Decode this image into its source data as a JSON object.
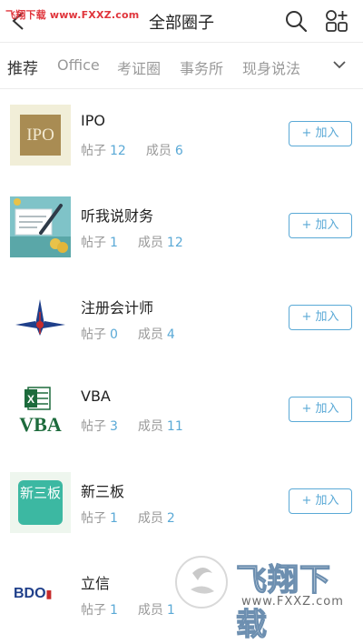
{
  "watermark_top": "飞翔下载 www.FXXZ.com",
  "header": {
    "title": "全部圈子",
    "icons": [
      "back-icon",
      "search-icon",
      "add-group-icon"
    ]
  },
  "tabs": [
    {
      "label": "推荐",
      "active": true
    },
    {
      "label": "Office",
      "active": false
    },
    {
      "label": "考证圈",
      "active": false
    },
    {
      "label": "事务所",
      "active": false
    },
    {
      "label": "现身说法",
      "active": false
    }
  ],
  "labels": {
    "posts": "帖子",
    "members": "成员",
    "join": "+ 加入"
  },
  "groups": [
    {
      "name": "IPO",
      "posts": "12",
      "members": "6",
      "thumb_text": "IPO"
    },
    {
      "name": "听我说财务",
      "posts": "1",
      "members": "12"
    },
    {
      "name": "注册会计师",
      "posts": "0",
      "members": "4"
    },
    {
      "name": "VBA",
      "posts": "3",
      "members": "11",
      "thumb_text": "VBA"
    },
    {
      "name": "新三板",
      "posts": "1",
      "members": "2",
      "thumb_text": "新三板"
    },
    {
      "name": "立信",
      "posts": "1",
      "members": "1",
      "thumb_text": "BDO"
    }
  ],
  "watermark_bottom": {
    "cn": "飞翔下载",
    "url": "www.FXXZ.com"
  },
  "colors": {
    "accent": "#5aa9d6",
    "watermark": "#e0353c"
  }
}
